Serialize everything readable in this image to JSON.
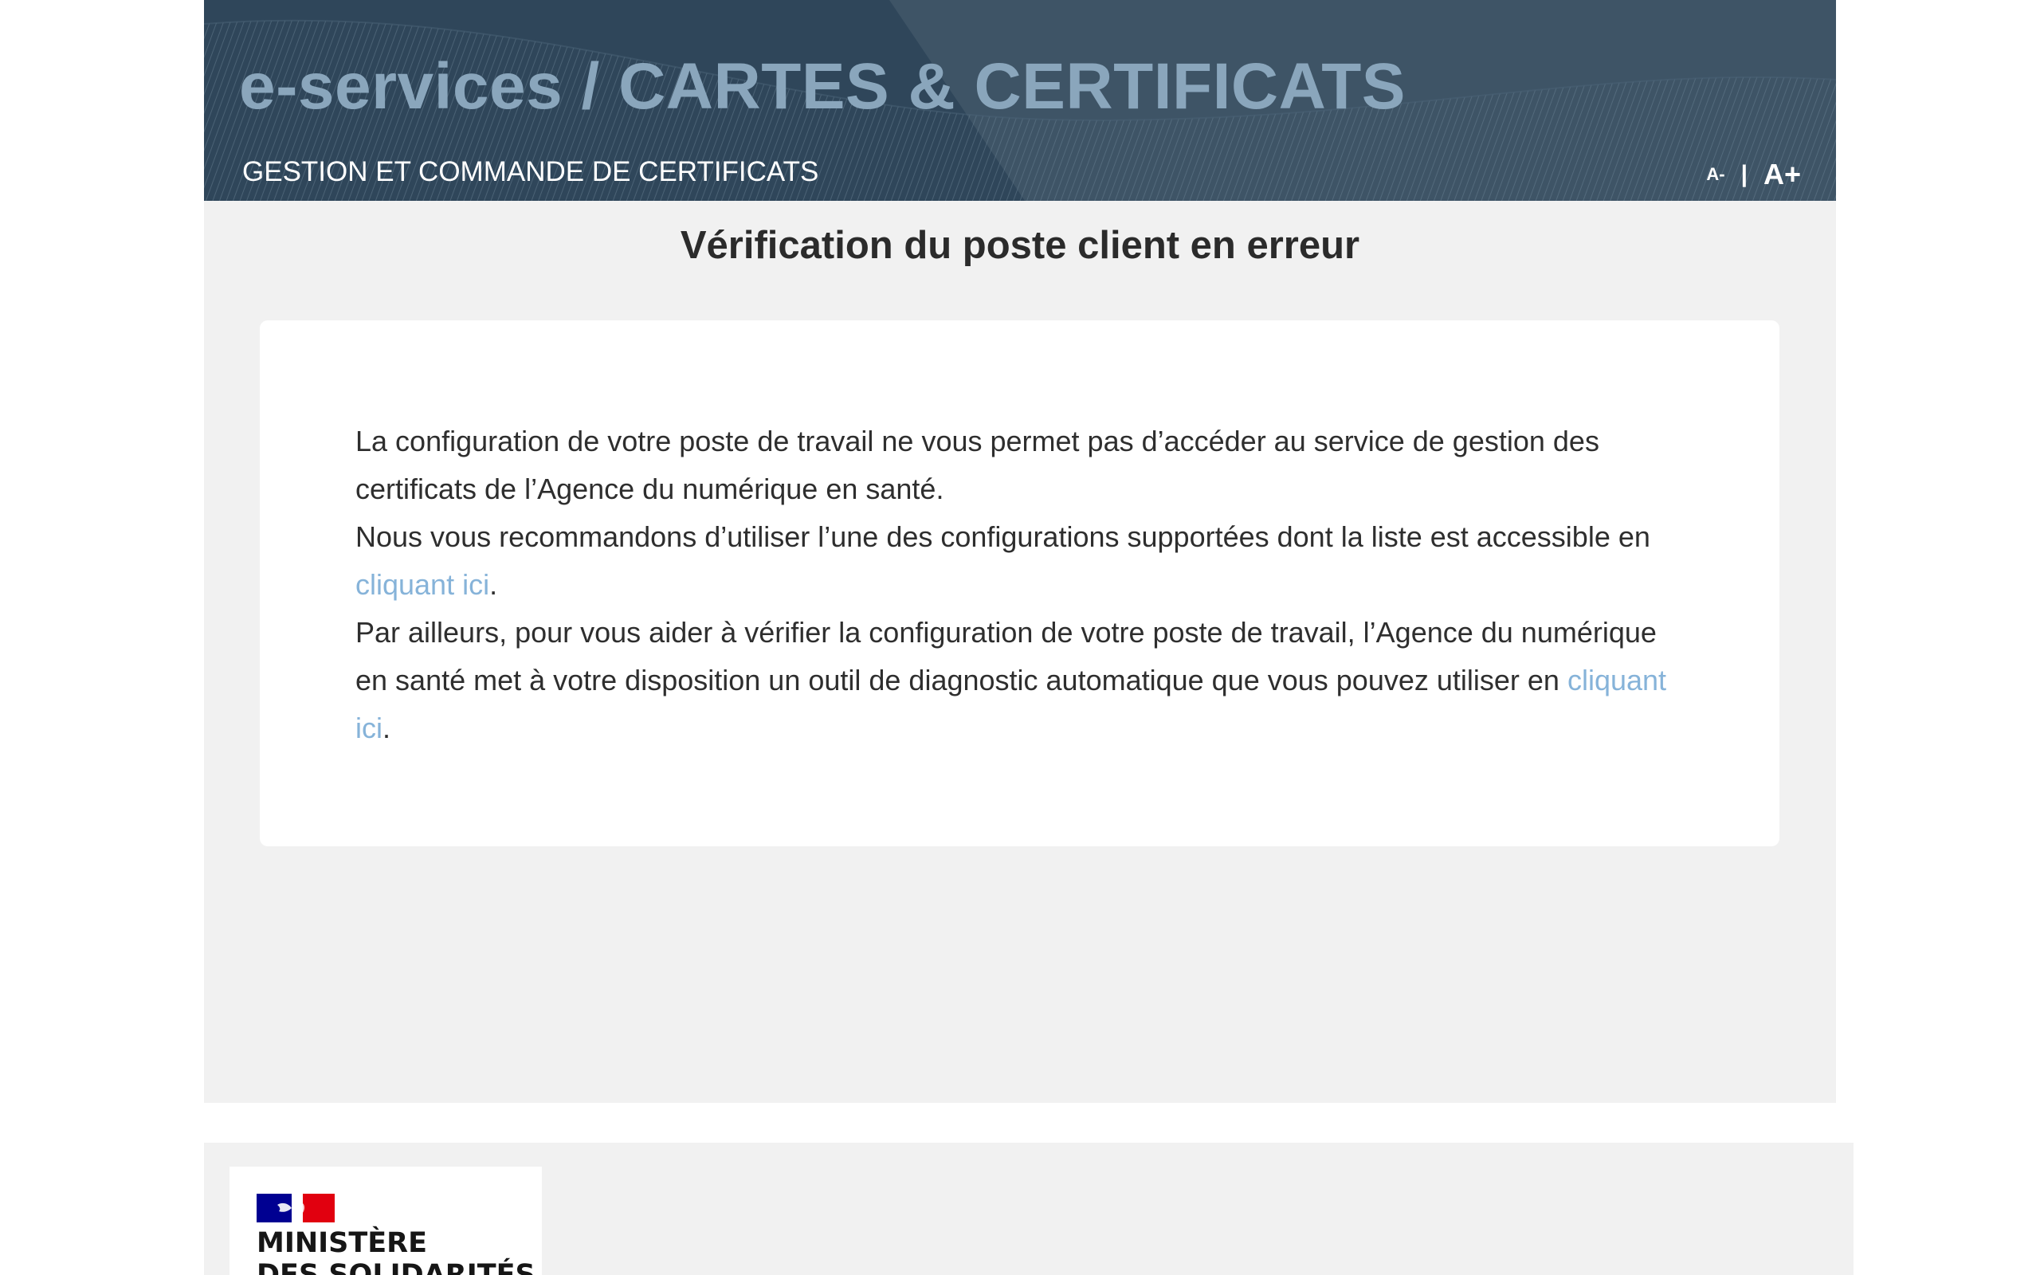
{
  "header": {
    "title": "e-services / CARTES & CERTIFICATS",
    "subtitle": "GESTION ET COMMANDE DE CERTIFICATS",
    "font_decrease": "A-",
    "font_separator": "|",
    "font_increase": "A+"
  },
  "main": {
    "title": "Vérification du poste client en erreur",
    "paragraph1": "La configuration de votre poste de travail ne vous permet pas d’accéder au service de gestion des certificats de l’Agence du numérique en santé.",
    "paragraph2_text": "Nous vous recommandons d’utiliser l’une des configurations supportées dont la liste est accessible en ",
    "paragraph2_link": "cliquant ici",
    "paragraph2_end": ".",
    "paragraph3_text": "Par ailleurs, pour vous aider à vérifier la configuration de votre poste de travail, l’Agence du numérique en santé met à votre disposition un outil de diagnostic automatique que vous pouvez utiliser en ",
    "paragraph3_link": "cliquant ici",
    "paragraph3_end": "."
  },
  "footer": {
    "ministry_line1": "MINISTÈRE",
    "ministry_line2": "DES SOLIDARITÉS",
    "flag_icon": "french-republic-flag-icon"
  },
  "colors": {
    "header_bg": "#3e5466",
    "header_title": "#8aa6bc",
    "page_bg": "#f1f1f1",
    "link": "#86b3d9",
    "flag_blue": "#000091",
    "flag_red": "#e1000f"
  }
}
